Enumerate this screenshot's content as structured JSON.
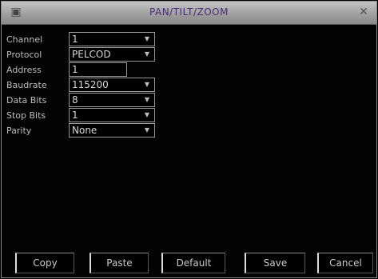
{
  "window": {
    "title": "PAN/TILT/ZOOM"
  },
  "fields": [
    {
      "label": "Channel",
      "value": "1",
      "kind": "select"
    },
    {
      "label": "Protocol",
      "value": "PELCOD",
      "kind": "select"
    },
    {
      "label": "Address",
      "value": "1",
      "kind": "text"
    },
    {
      "label": "Baudrate",
      "value": "115200",
      "kind": "select"
    },
    {
      "label": "Data Bits",
      "value": "8",
      "kind": "select"
    },
    {
      "label": "Stop Bits",
      "value": "1",
      "kind": "select"
    },
    {
      "label": "Parity",
      "value": "None",
      "kind": "select"
    }
  ],
  "buttons": {
    "copy": "Copy",
    "paste": "Paste",
    "default": "Default",
    "save": "Save",
    "cancel": "Cancel"
  },
  "icons": {
    "window": "dvr-icon",
    "close": "close-icon",
    "dropdown": "chevron-down-icon"
  }
}
